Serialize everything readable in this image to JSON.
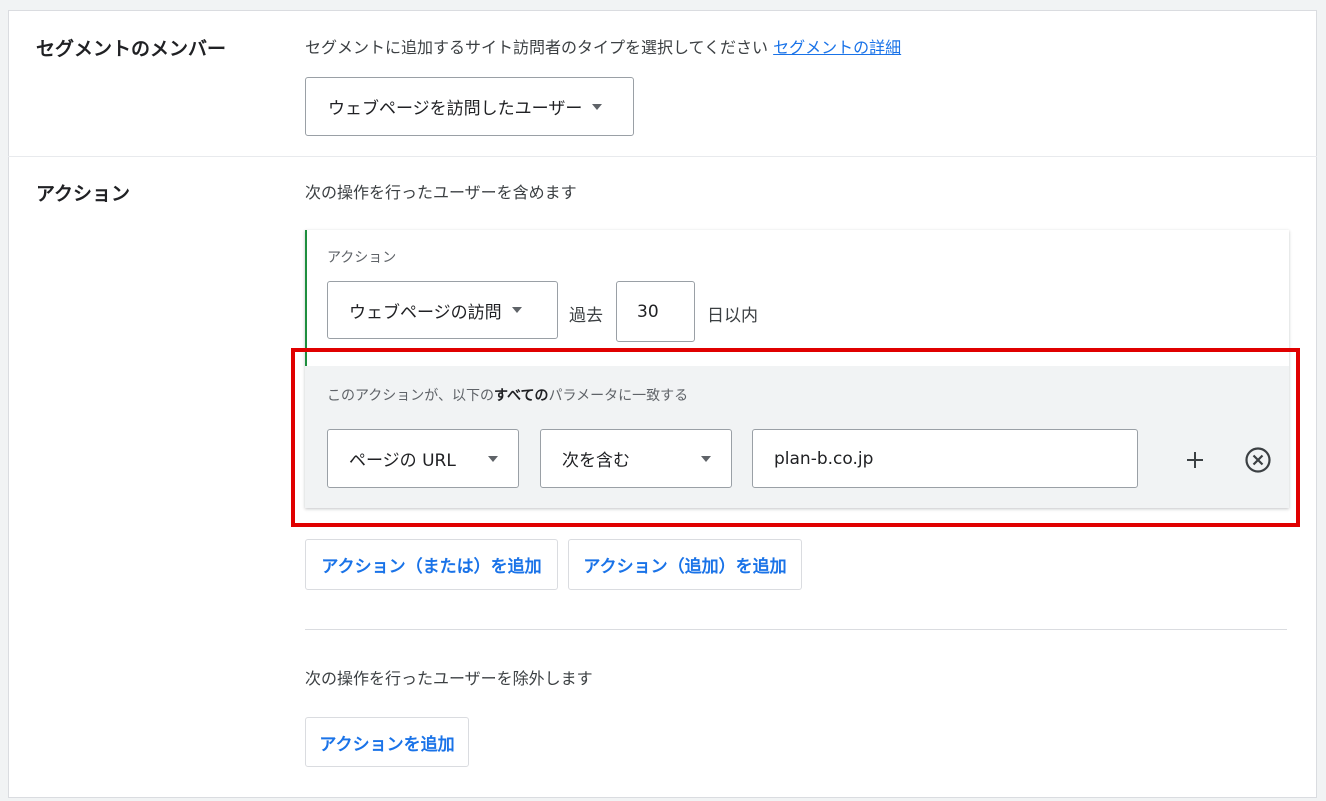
{
  "segment_members": {
    "title": "セグメントのメンバー",
    "description": "セグメントに追加するサイト訪問者のタイプを選択してください",
    "link": "セグメントの詳細",
    "dropdown_value": "ウェブページを訪問したユーザー"
  },
  "actions": {
    "title": "アクション",
    "include_description": "次の操作を行ったユーザーを含めます",
    "action_card": {
      "label": "アクション",
      "action_dropdown": "ウェブページの訪問",
      "past_label": "過去",
      "days_value": "30",
      "days_suffix": "日以内"
    },
    "parameters": {
      "label_prefix": "このアクションが、以下の",
      "label_bold": "すべての",
      "label_suffix": "パラメータに一致する",
      "field_dropdown": "ページの URL",
      "operator_dropdown": "次を含む",
      "value": "plan-b.co.jp"
    },
    "add_or_button": "アクション（または）を追加",
    "add_and_button": "アクション（追加）を追加",
    "exclude_description": "次の操作を行ったユーザーを除外します",
    "add_action_button": "アクションを追加"
  },
  "colors": {
    "accent": "#1a73e8",
    "highlight": "#e00000",
    "action_border": "#1e8e3e"
  },
  "icons": {
    "dropdown": "chevron-down-icon",
    "add": "plus-icon",
    "remove": "circle-x-icon"
  }
}
